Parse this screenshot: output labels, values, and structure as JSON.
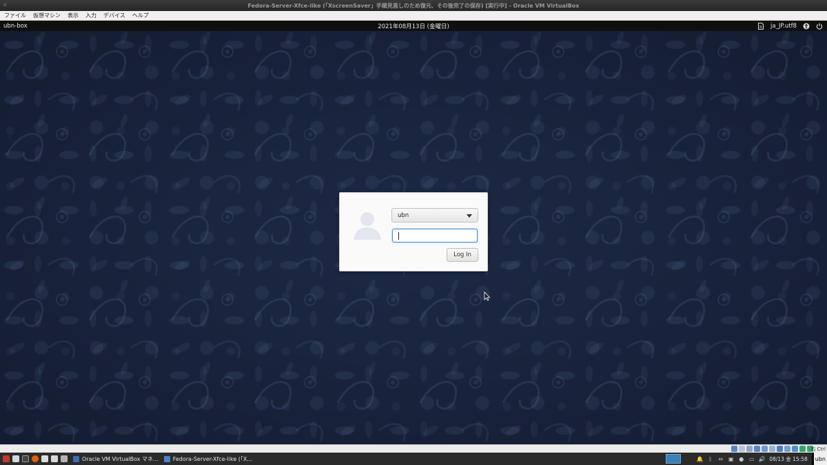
{
  "window": {
    "title": "Fedora-Server-Xfce-like (「XscreenSaver」手順見直しのため復元、その後完了の保存) [実行中] - Oracle VM VirtualBox"
  },
  "menubar": {
    "items": [
      {
        "label": "ファイル"
      },
      {
        "label": "仮想マシン"
      },
      {
        "label": "表示"
      },
      {
        "label": "入力"
      },
      {
        "label": "デバイス"
      },
      {
        "label": "ヘルプ"
      }
    ]
  },
  "guest_bar": {
    "hostname": "ubn-box",
    "clock": "2021年08月13日 (金曜日)",
    "locale": "ja_JP.utf8",
    "icons": [
      "document-icon",
      "accessibility-icon",
      "power-icon"
    ]
  },
  "login": {
    "selected_user": "ubn",
    "password_value": "",
    "login_button": "Log In"
  },
  "vbox_status": {
    "host_key": "右 Ctrl"
  },
  "taskbar": {
    "tasks": [
      {
        "label": "Oracle VM VirtualBox マネ..."
      },
      {
        "label": "Fedora-Server-Xfce-like (「X..."
      }
    ],
    "clock": "08/13 金 15:58",
    "user": "ubn"
  },
  "colors": {
    "desktop_bg": "#17213a",
    "accent": "#4a90d9"
  }
}
